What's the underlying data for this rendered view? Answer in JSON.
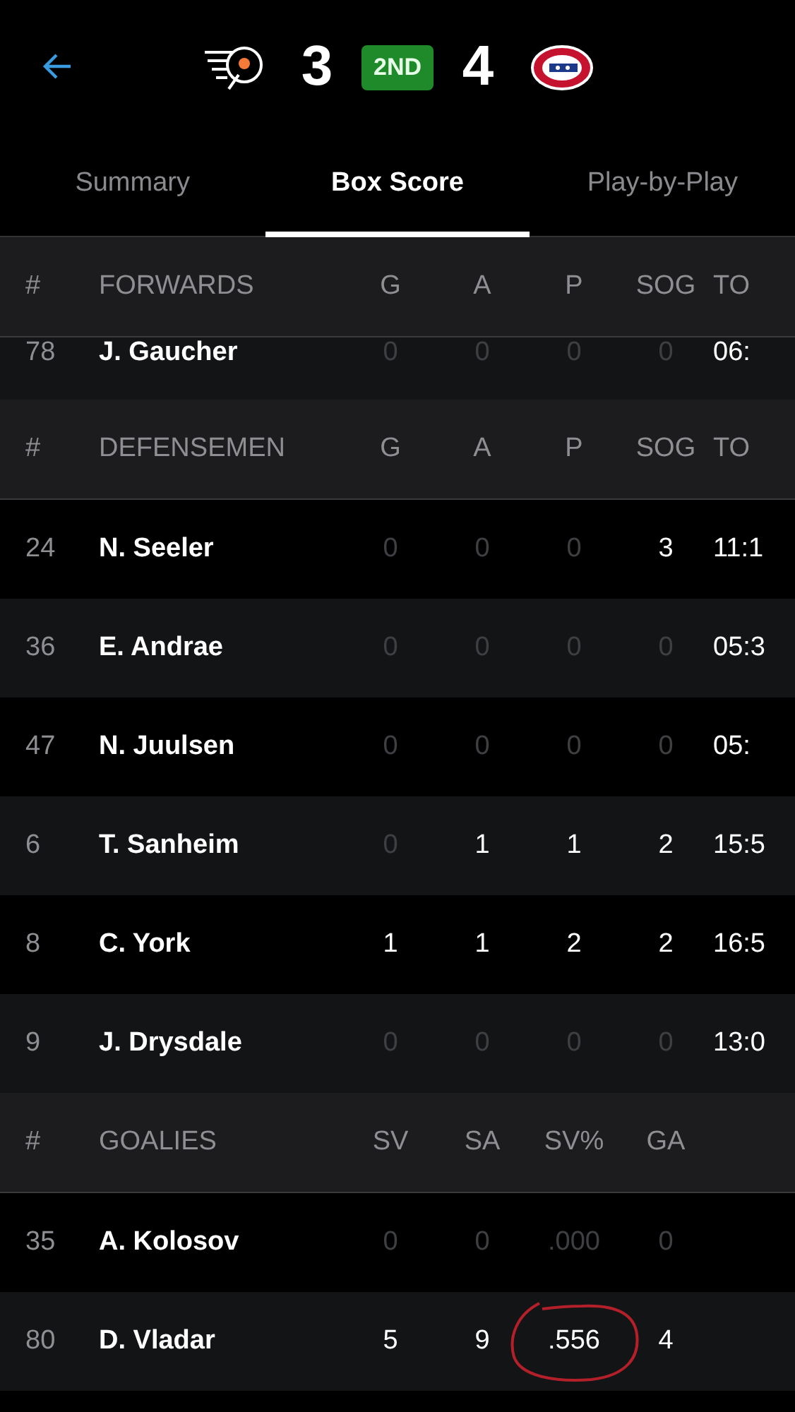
{
  "header": {
    "home_score": "3",
    "period": "2ND",
    "away_score": "4"
  },
  "tabs": [
    {
      "label": "Summary",
      "selected": false
    },
    {
      "label": "Box Score",
      "selected": true
    },
    {
      "label": "Play-by-Play",
      "selected": false
    }
  ],
  "sections": [
    {
      "number_header": "#",
      "title": "FORWARDS",
      "columns": [
        "G",
        "A",
        "P",
        "SOG",
        "TO"
      ],
      "rows": [
        {
          "number": "78",
          "name": "J. Gaucher",
          "partial": true,
          "stats": [
            {
              "value": "0",
              "dim": true
            },
            {
              "value": "0",
              "dim": true
            },
            {
              "value": "0",
              "dim": true
            },
            {
              "value": "0",
              "dim": true
            },
            {
              "value": "06:",
              "dim": false
            }
          ]
        }
      ]
    },
    {
      "number_header": "#",
      "title": "DEFENSEMEN",
      "columns": [
        "G",
        "A",
        "P",
        "SOG",
        "TO"
      ],
      "rows": [
        {
          "number": "24",
          "name": "N. Seeler",
          "stats": [
            {
              "value": "0",
              "dim": true
            },
            {
              "value": "0",
              "dim": true
            },
            {
              "value": "0",
              "dim": true
            },
            {
              "value": "3",
              "dim": false
            },
            {
              "value": "11:1",
              "dim": false
            }
          ]
        },
        {
          "number": "36",
          "name": "E. Andrae",
          "stats": [
            {
              "value": "0",
              "dim": true
            },
            {
              "value": "0",
              "dim": true
            },
            {
              "value": "0",
              "dim": true
            },
            {
              "value": "0",
              "dim": true
            },
            {
              "value": "05:3",
              "dim": false
            }
          ]
        },
        {
          "number": "47",
          "name": "N. Juulsen",
          "stats": [
            {
              "value": "0",
              "dim": true
            },
            {
              "value": "0",
              "dim": true
            },
            {
              "value": "0",
              "dim": true
            },
            {
              "value": "0",
              "dim": true
            },
            {
              "value": "05:",
              "dim": false
            }
          ]
        },
        {
          "number": "6",
          "name": "T. Sanheim",
          "stats": [
            {
              "value": "0",
              "dim": true
            },
            {
              "value": "1",
              "dim": false
            },
            {
              "value": "1",
              "dim": false
            },
            {
              "value": "2",
              "dim": false
            },
            {
              "value": "15:5",
              "dim": false
            }
          ]
        },
        {
          "number": "8",
          "name": "C. York",
          "stats": [
            {
              "value": "1",
              "dim": false
            },
            {
              "value": "1",
              "dim": false
            },
            {
              "value": "2",
              "dim": false
            },
            {
              "value": "2",
              "dim": false
            },
            {
              "value": "16:5",
              "dim": false
            }
          ]
        },
        {
          "number": "9",
          "name": "J. Drysdale",
          "stats": [
            {
              "value": "0",
              "dim": true
            },
            {
              "value": "0",
              "dim": true
            },
            {
              "value": "0",
              "dim": true
            },
            {
              "value": "0",
              "dim": true
            },
            {
              "value": "13:0",
              "dim": false
            }
          ]
        }
      ]
    },
    {
      "number_header": "#",
      "title": "GOALIES",
      "columns": [
        "SV",
        "SA",
        "SV%",
        "GA"
      ],
      "rows": [
        {
          "number": "35",
          "name": "A. Kolosov",
          "stats": [
            {
              "value": "0",
              "dim": true
            },
            {
              "value": "0",
              "dim": true
            },
            {
              "value": ".000",
              "dim": true
            },
            {
              "value": "0",
              "dim": true
            }
          ]
        },
        {
          "number": "80",
          "name": "D. Vladar",
          "stats": [
            {
              "value": "5",
              "dim": false
            },
            {
              "value": "9",
              "dim": false
            },
            {
              "value": ".556",
              "dim": false,
              "circled": true
            },
            {
              "value": "4",
              "dim": false
            }
          ]
        }
      ]
    }
  ]
}
